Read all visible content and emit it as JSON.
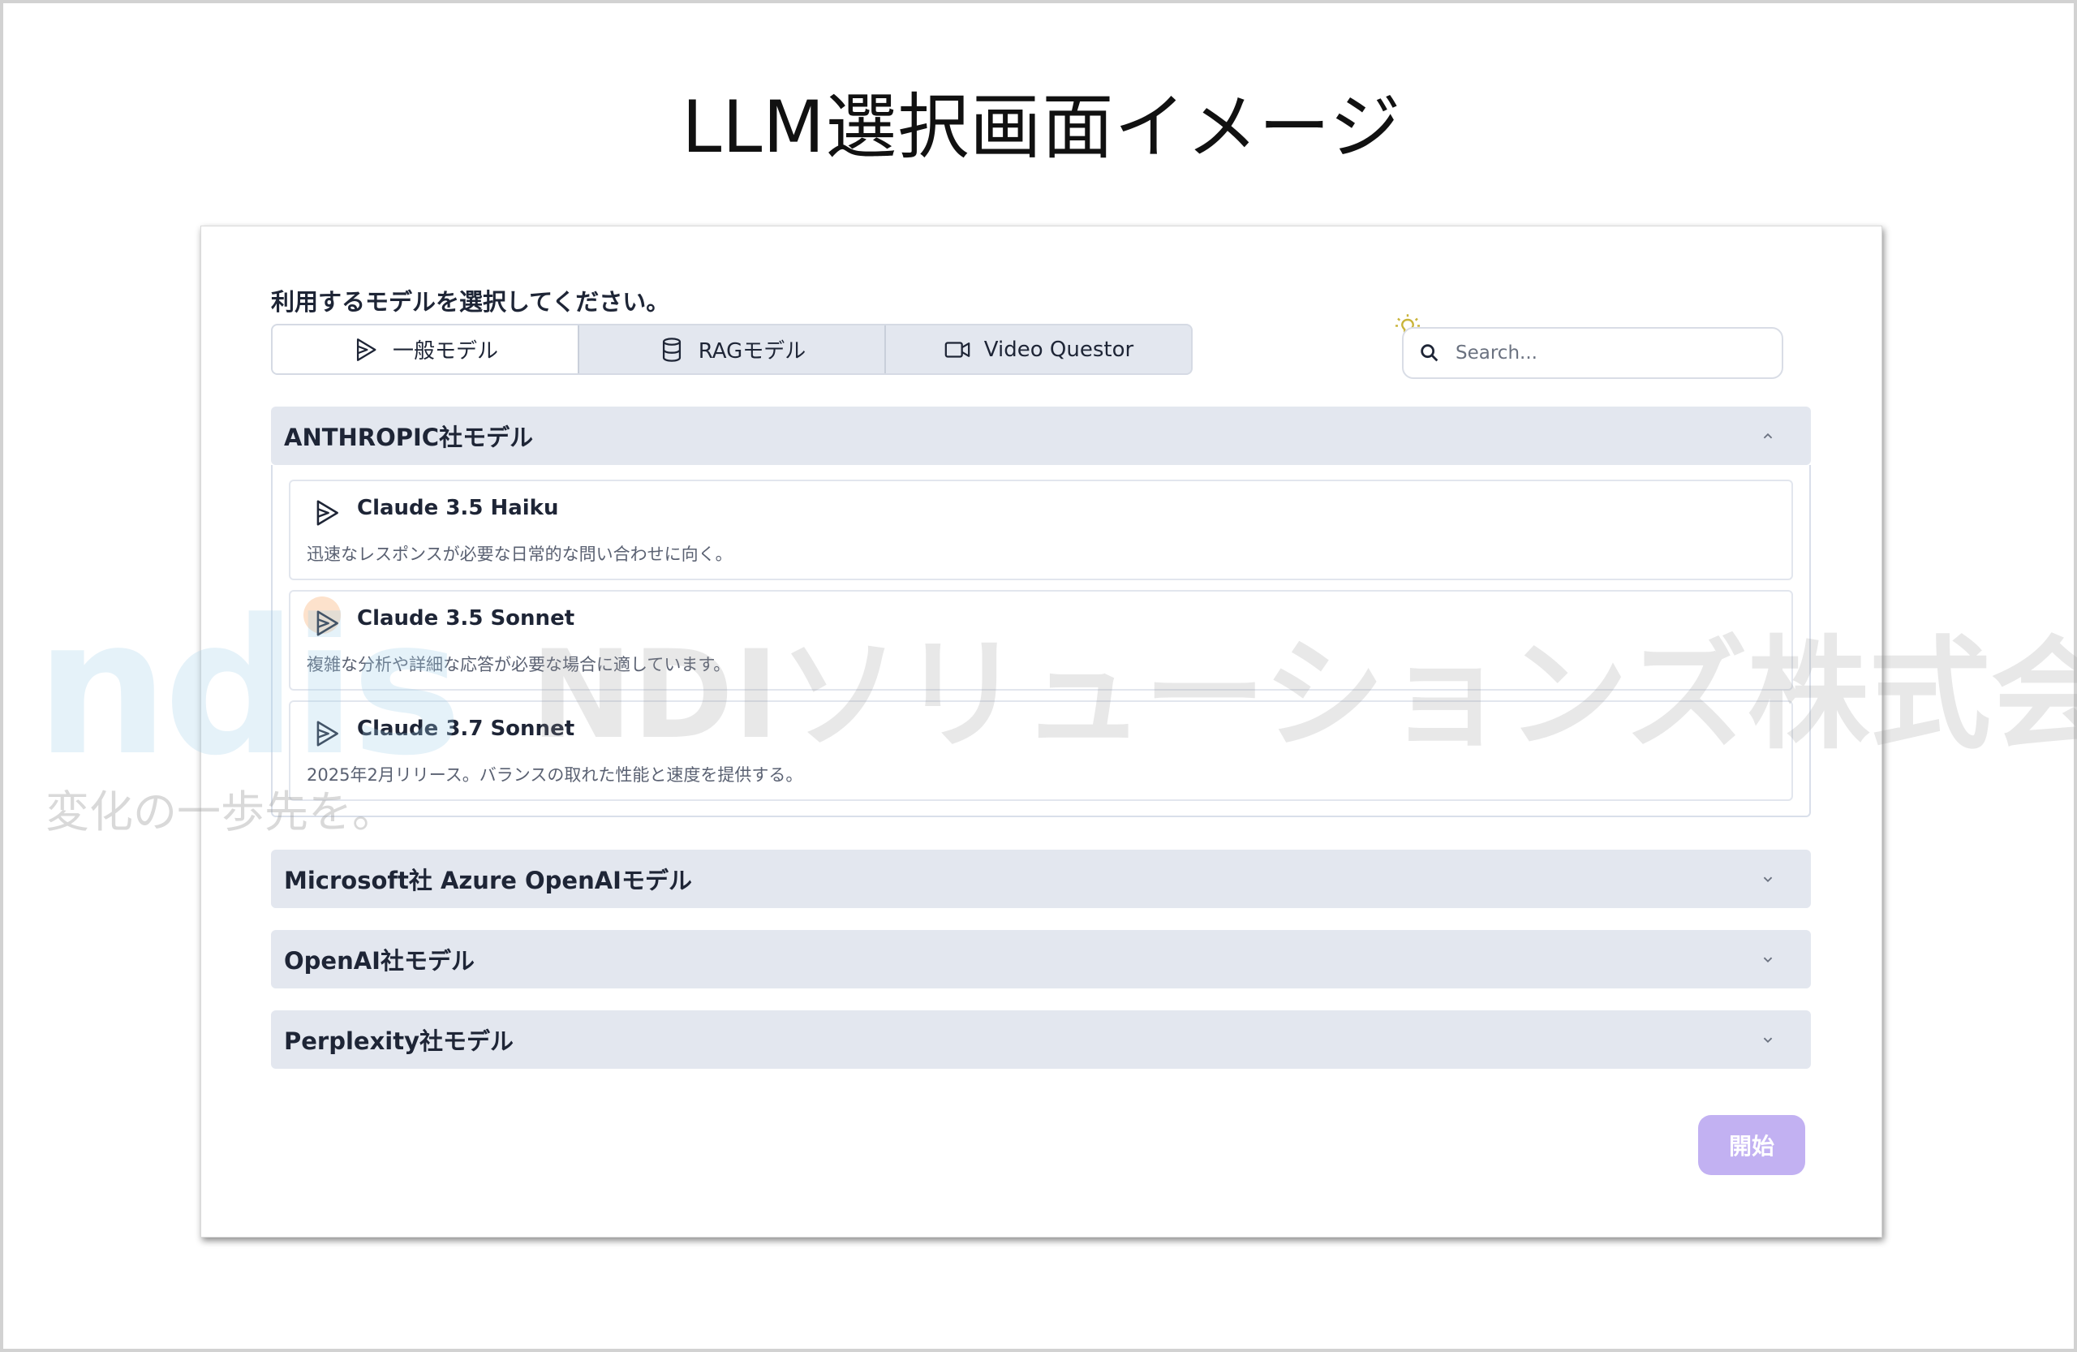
{
  "slide": {
    "title": "LLM選択画面イメージ"
  },
  "prompt": "利用するモデルを選択してください。",
  "tabs": [
    {
      "label": "一般モデル",
      "icon": "play-icon",
      "active": true
    },
    {
      "label": "RAGモデル",
      "icon": "database-icon",
      "active": false
    },
    {
      "label": "Video Questor",
      "icon": "video-icon",
      "active": false
    }
  ],
  "search": {
    "placeholder": "Search..."
  },
  "groups": [
    {
      "title": "ANTHROPIC社モデル",
      "expanded": true,
      "models": [
        {
          "name": "Claude 3.5 Haiku",
          "desc": "迅速なレスポンスが必要な日常的な問い合わせに向く。"
        },
        {
          "name": "Claude 3.5 Sonnet",
          "desc": "複雑な分析や詳細な応答が必要な場合に適しています。"
        },
        {
          "name": "Claude 3.7 Sonnet",
          "desc": "2025年2月リリース。バランスの取れた性能と速度を提供する。"
        }
      ]
    },
    {
      "title": "Microsoft社 Azure OpenAIモデル",
      "expanded": false
    },
    {
      "title": "OpenAI社モデル",
      "expanded": false
    },
    {
      "title": "Perplexity社モデル",
      "expanded": false
    }
  ],
  "start_button": "開始",
  "watermark": {
    "logo": "ndis",
    "tagline": "変化の一歩先を。",
    "company": "NDIソリューションズ株式会社"
  },
  "colors": {
    "accent_button": "#c2b1f2",
    "header_bg": "#e3e7ef",
    "text": "#1e2536"
  }
}
